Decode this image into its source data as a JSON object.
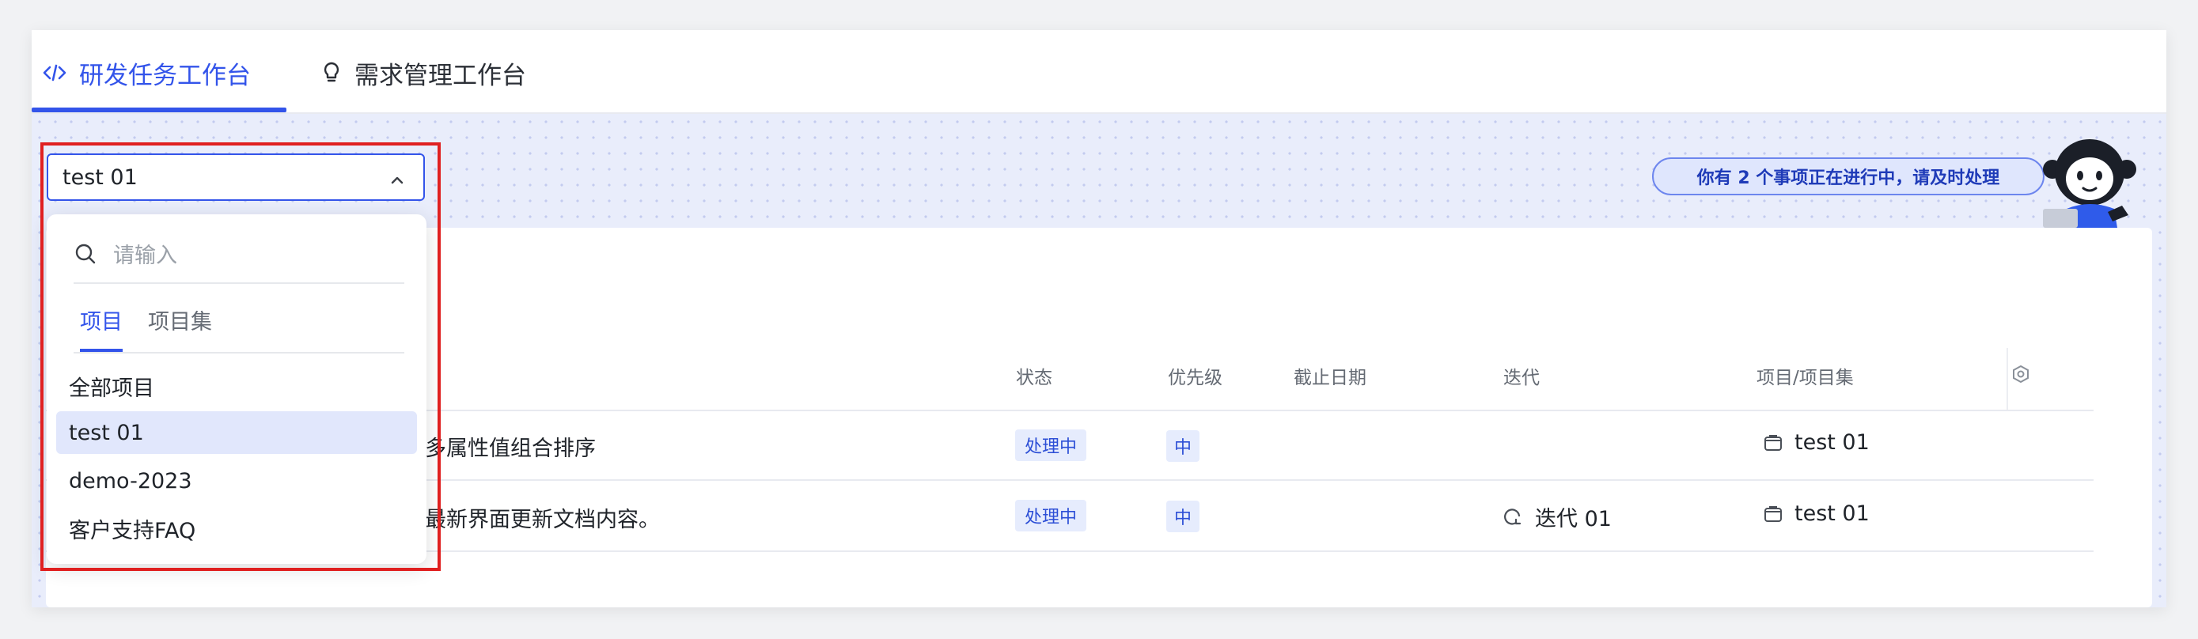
{
  "tabs": [
    {
      "label": "研发任务工作台",
      "icon": "code-icon",
      "active": true
    },
    {
      "label": "需求管理工作台",
      "icon": "lightbulb-icon",
      "active": false
    }
  ],
  "notice": {
    "text": "你有 2 个事项正在进行中，请及时处理"
  },
  "table": {
    "columns": [
      "状态",
      "优先级",
      "截止日期",
      "迭代",
      "项目/项目集"
    ],
    "rows": [
      {
        "title": "多属性值组合排序",
        "status": "处理中",
        "priority": "中",
        "due": "",
        "iteration": "",
        "project": "test 01"
      },
      {
        "title": "最新界面更新文档内容。",
        "status": "处理中",
        "priority": "中",
        "due": "",
        "iteration": "迭代 01",
        "project": "test 01"
      }
    ]
  },
  "selector": {
    "value": "test 01",
    "search_placeholder": "请输入",
    "tabs": [
      "项目",
      "项目集"
    ],
    "options": [
      "全部项目",
      "test 01",
      "demo-2023",
      "客户支持FAQ"
    ],
    "selected_option": "test 01"
  },
  "colors": {
    "accent": "#3354ea",
    "highlight": "#e02020",
    "tag_bg": "#e6ecfd"
  }
}
